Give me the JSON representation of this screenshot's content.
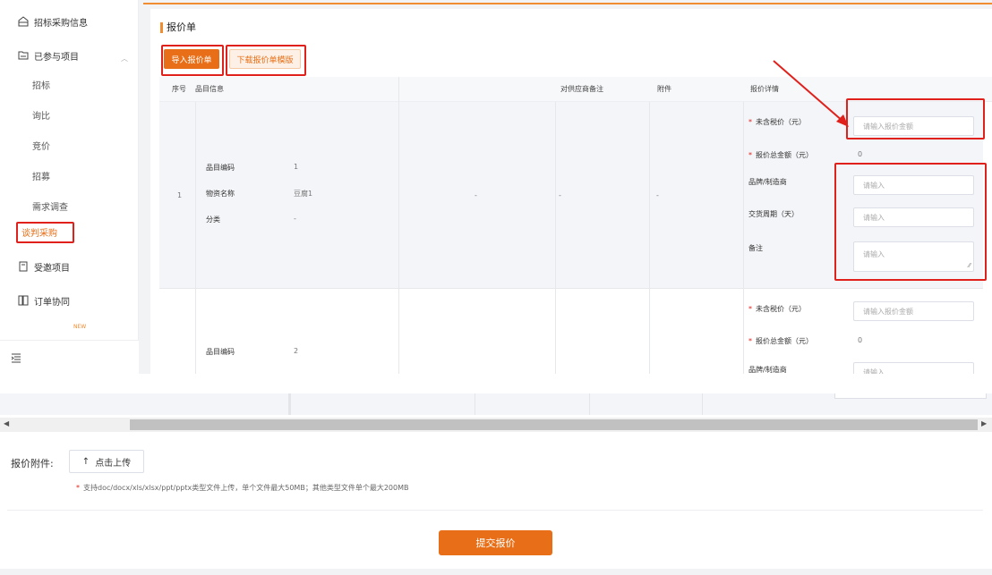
{
  "sidebar": {
    "top_item": "招标采购信息",
    "participated": "已参与项目",
    "sub_items": [
      "招标",
      "询比",
      "竞价",
      "招募",
      "需求调查",
      "谈判采购"
    ],
    "invited": "受邀项目",
    "order": "订单协同",
    "new_badge": "NEW"
  },
  "page": {
    "title": "报价单"
  },
  "buttons": {
    "import": "导入报价单",
    "download_template": "下载报价单模版"
  },
  "table": {
    "headers": {
      "index": "序号",
      "item_info": "品目信息",
      "supplier_note": "对供应商备注",
      "attachment": "附件",
      "quote_detail": "报价详情"
    },
    "row1": {
      "index": "1",
      "code_label": "品目编码",
      "code_value": "1",
      "name_label": "物资名称",
      "name_value": "豆腐1",
      "category_label": "分类",
      "category_value": "-",
      "dash_a": "-",
      "dash_b": "-",
      "dash_c": "-",
      "price_label": "未含税价（元）",
      "price_placeholder": "请输入报价金额",
      "total_label": "报价总金额（元）",
      "total_value": "0",
      "brand_label": "品牌/制造商",
      "brand_placeholder": "请输入",
      "delivery_label": "交货周期（天）",
      "delivery_placeholder": "请输入",
      "remark_label": "备注",
      "remark_placeholder": "请输入"
    },
    "row2": {
      "code_label": "品目编码",
      "code_value": "2",
      "price_label": "未含税价（元）",
      "price_placeholder": "请输入报价金额",
      "total_label": "报价总金额（元）",
      "total_value": "0",
      "brand_label": "品牌/制造商",
      "brand_placeholder": "请输入"
    }
  },
  "attachment": {
    "label": "报价附件:",
    "upload": "点击上传",
    "hint_star": "*",
    "hint": "支持doc/docx/xls/xlsx/ppt/pptx类型文件上传，单个文件最大50MB；其他类型文件单个最大200MB"
  },
  "submit": "提交报价",
  "colors": {
    "accent": "#e86f17",
    "highlight": "#e0201b"
  }
}
